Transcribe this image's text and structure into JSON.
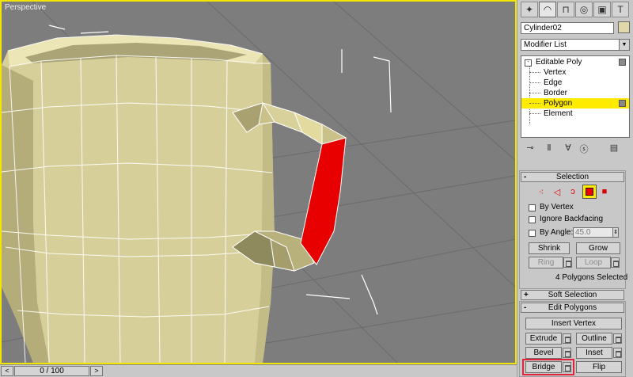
{
  "viewport": {
    "label": "Perspective",
    "colors": {
      "background": "#7d7d7d",
      "active_border": "#f2e600",
      "mug": "#d7cf9a",
      "selected_face": "#e80000",
      "wire": "#ffffff"
    }
  },
  "timebar": {
    "frame_label": "0 / 100",
    "prev_glyph": "<",
    "next_glyph": ">"
  },
  "panel": {
    "tabs": [
      {
        "name": "create-tab",
        "glyph": "✦"
      },
      {
        "name": "modify-tab",
        "glyph": "◠"
      },
      {
        "name": "hierarchy-tab",
        "glyph": "⊓"
      },
      {
        "name": "motion-tab",
        "glyph": "◎"
      },
      {
        "name": "display-tab",
        "glyph": "▣"
      },
      {
        "name": "utilities-tab",
        "glyph": "T"
      }
    ],
    "object_name": "Cylinder02",
    "object_color": "#e0d8a8",
    "modifier_list_label": "Modifier List",
    "stack": {
      "root": "Editable Poly",
      "items": [
        "Vertex",
        "Edge",
        "Border",
        "Polygon",
        "Element"
      ],
      "selected": "Polygon",
      "selected_color": "#ffeb00"
    },
    "stack_tools": [
      "pin-stack-icon",
      "show-end-result-icon",
      "make-unique-icon",
      "remove-modifier-icon",
      "configure-sets-icon"
    ],
    "selection": {
      "title": "Selection",
      "by_vertex_label": "By Vertex",
      "ignore_backfacing_label": "Ignore Backfacing",
      "by_angle_label": "By Angle:",
      "angle_value": "45.0",
      "shrink_label": "Shrink",
      "grow_label": "Grow",
      "ring_label": "Ring",
      "loop_label": "Loop",
      "status": "4 Polygons Selected"
    },
    "soft_selection": {
      "title": "Soft Selection",
      "sign": "+"
    },
    "edit_polygons": {
      "title": "Edit Polygons",
      "sign": "-",
      "insert_vertex_label": "Insert Vertex",
      "extrude_label": "Extrude",
      "outline_label": "Outline",
      "bevel_label": "Bevel",
      "inset_label": "Inset",
      "bridge_label": "Bridge",
      "flip_label": "Flip",
      "highlight_color": "#e0243c"
    }
  }
}
